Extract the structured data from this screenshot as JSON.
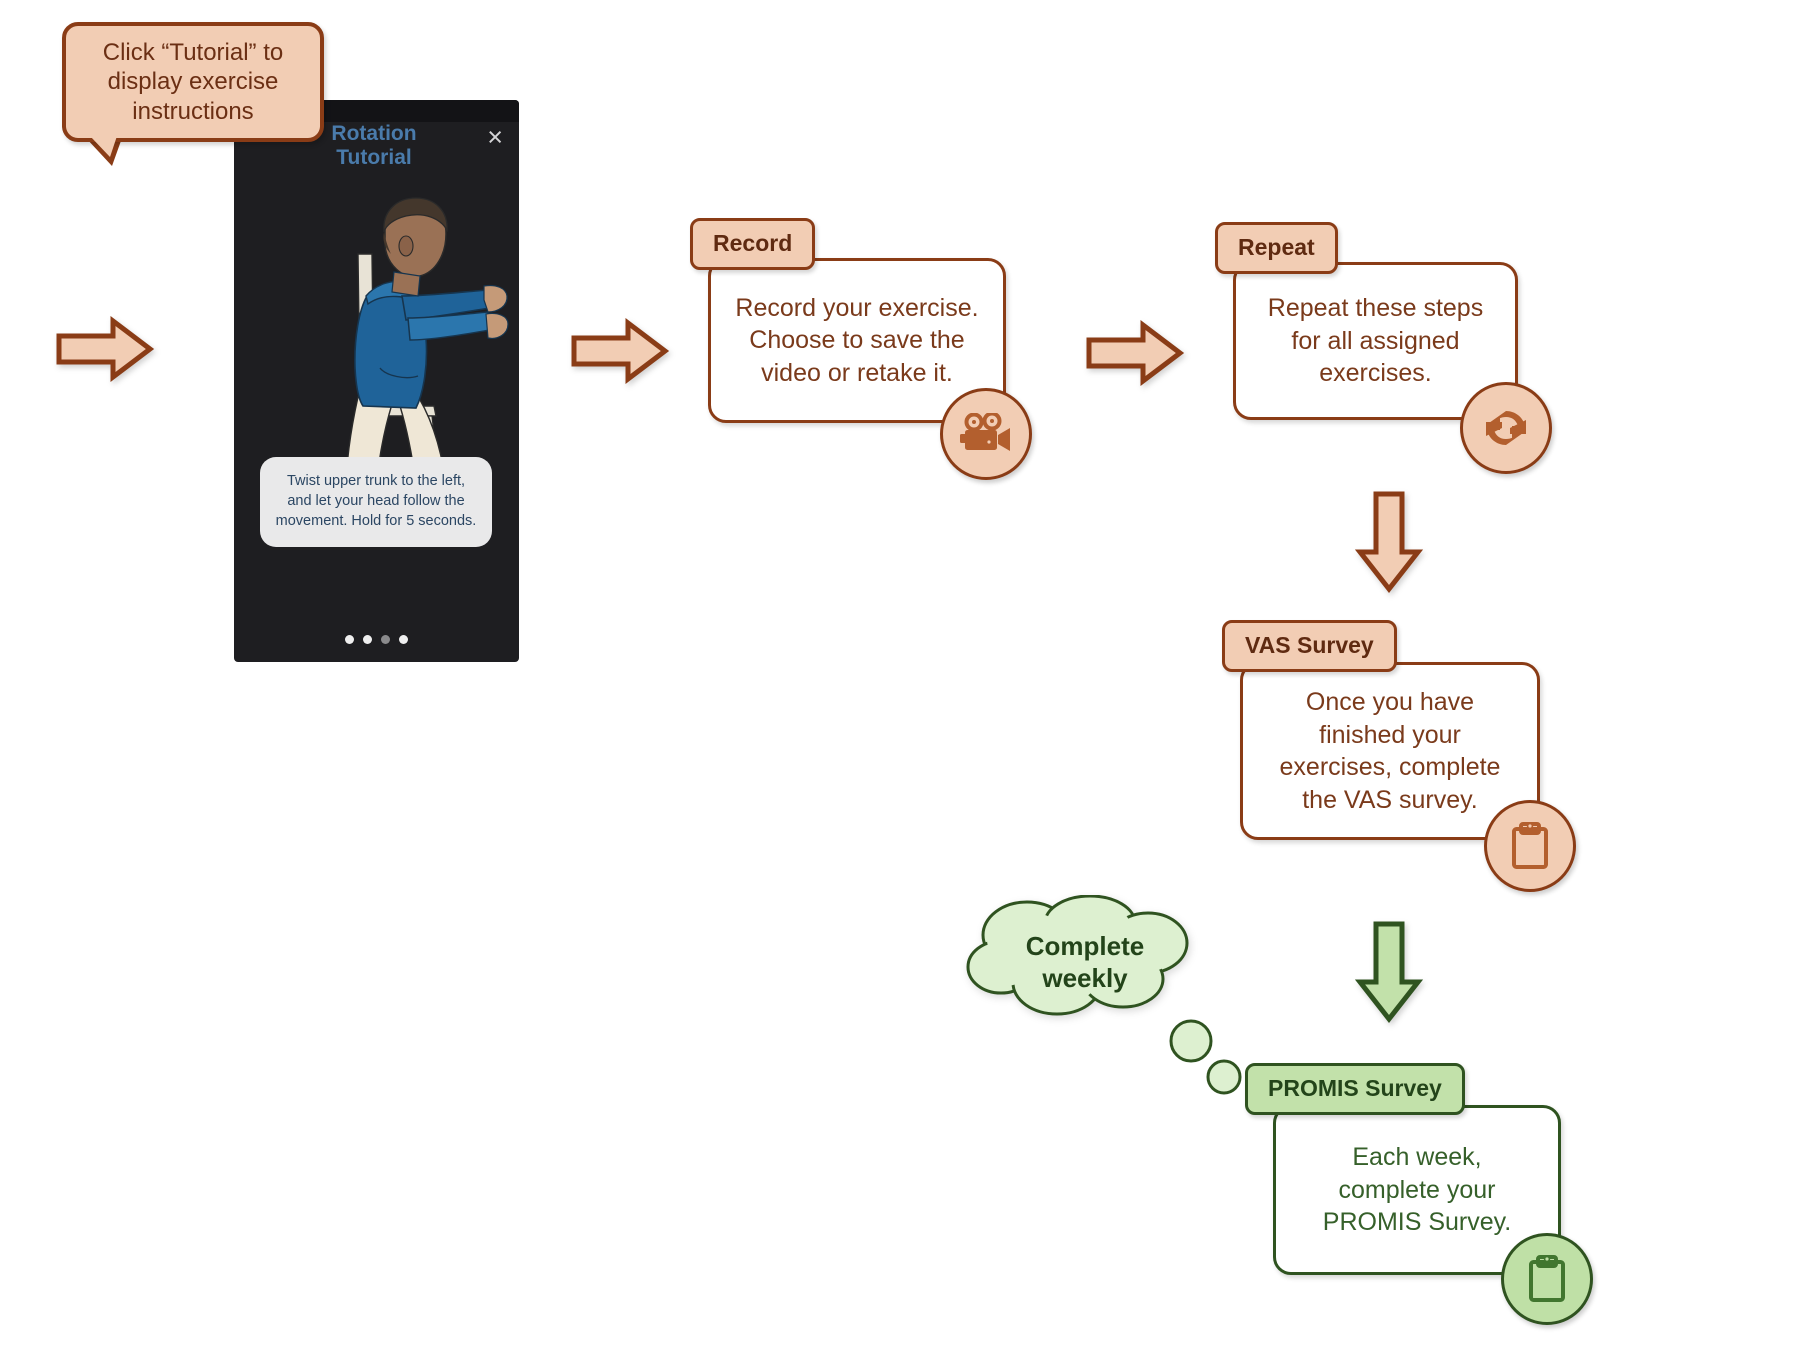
{
  "tooltip": {
    "text": "Click “Tutorial” to display exercise instructions"
  },
  "phone": {
    "title": "Rotation Tutorial",
    "close_label": "×",
    "caption": "Twist upper trunk to the left, and let your head follow the movement. Hold for 5 seconds.",
    "dots": [
      {
        "state": "light"
      },
      {
        "state": "light"
      },
      {
        "state": "dim"
      },
      {
        "state": "light"
      }
    ]
  },
  "steps": [
    {
      "id": "record",
      "label": "Record",
      "body": "Record your exercise. Choose to save the video or retake it.",
      "icon": "movie-camera-icon",
      "theme": "brown"
    },
    {
      "id": "repeat",
      "label": "Repeat",
      "body": "Repeat these steps for all assigned exercises.",
      "icon": "refresh-icon",
      "theme": "brown"
    },
    {
      "id": "vas-survey",
      "label": "VAS Survey",
      "body": "Once you have finished your exercises, complete the VAS survey.",
      "icon": "clipboard-icon",
      "theme": "brown"
    },
    {
      "id": "promis-survey",
      "label": "PROMIS Survey",
      "body": "Each week, complete your PROMIS Survey.",
      "icon": "clipboard-icon",
      "theme": "green"
    }
  ],
  "cloud": {
    "line1": "Complete",
    "line2": "weekly"
  },
  "colors": {
    "peach_fill": "#f2cdb4",
    "brown_border": "#8a3c16",
    "brown_text": "#7a3a1b",
    "brown_icon": "#b35f2e",
    "green_fill": "#c2e1aa",
    "green_pale": "#ddf0d0",
    "green_border": "#2f5320",
    "green_text": "#36602a",
    "phone_bg": "#1e1e21",
    "phone_title": "#4a7bab",
    "caption_bg": "#e9e9ea",
    "caption_text": "#2b4663"
  }
}
